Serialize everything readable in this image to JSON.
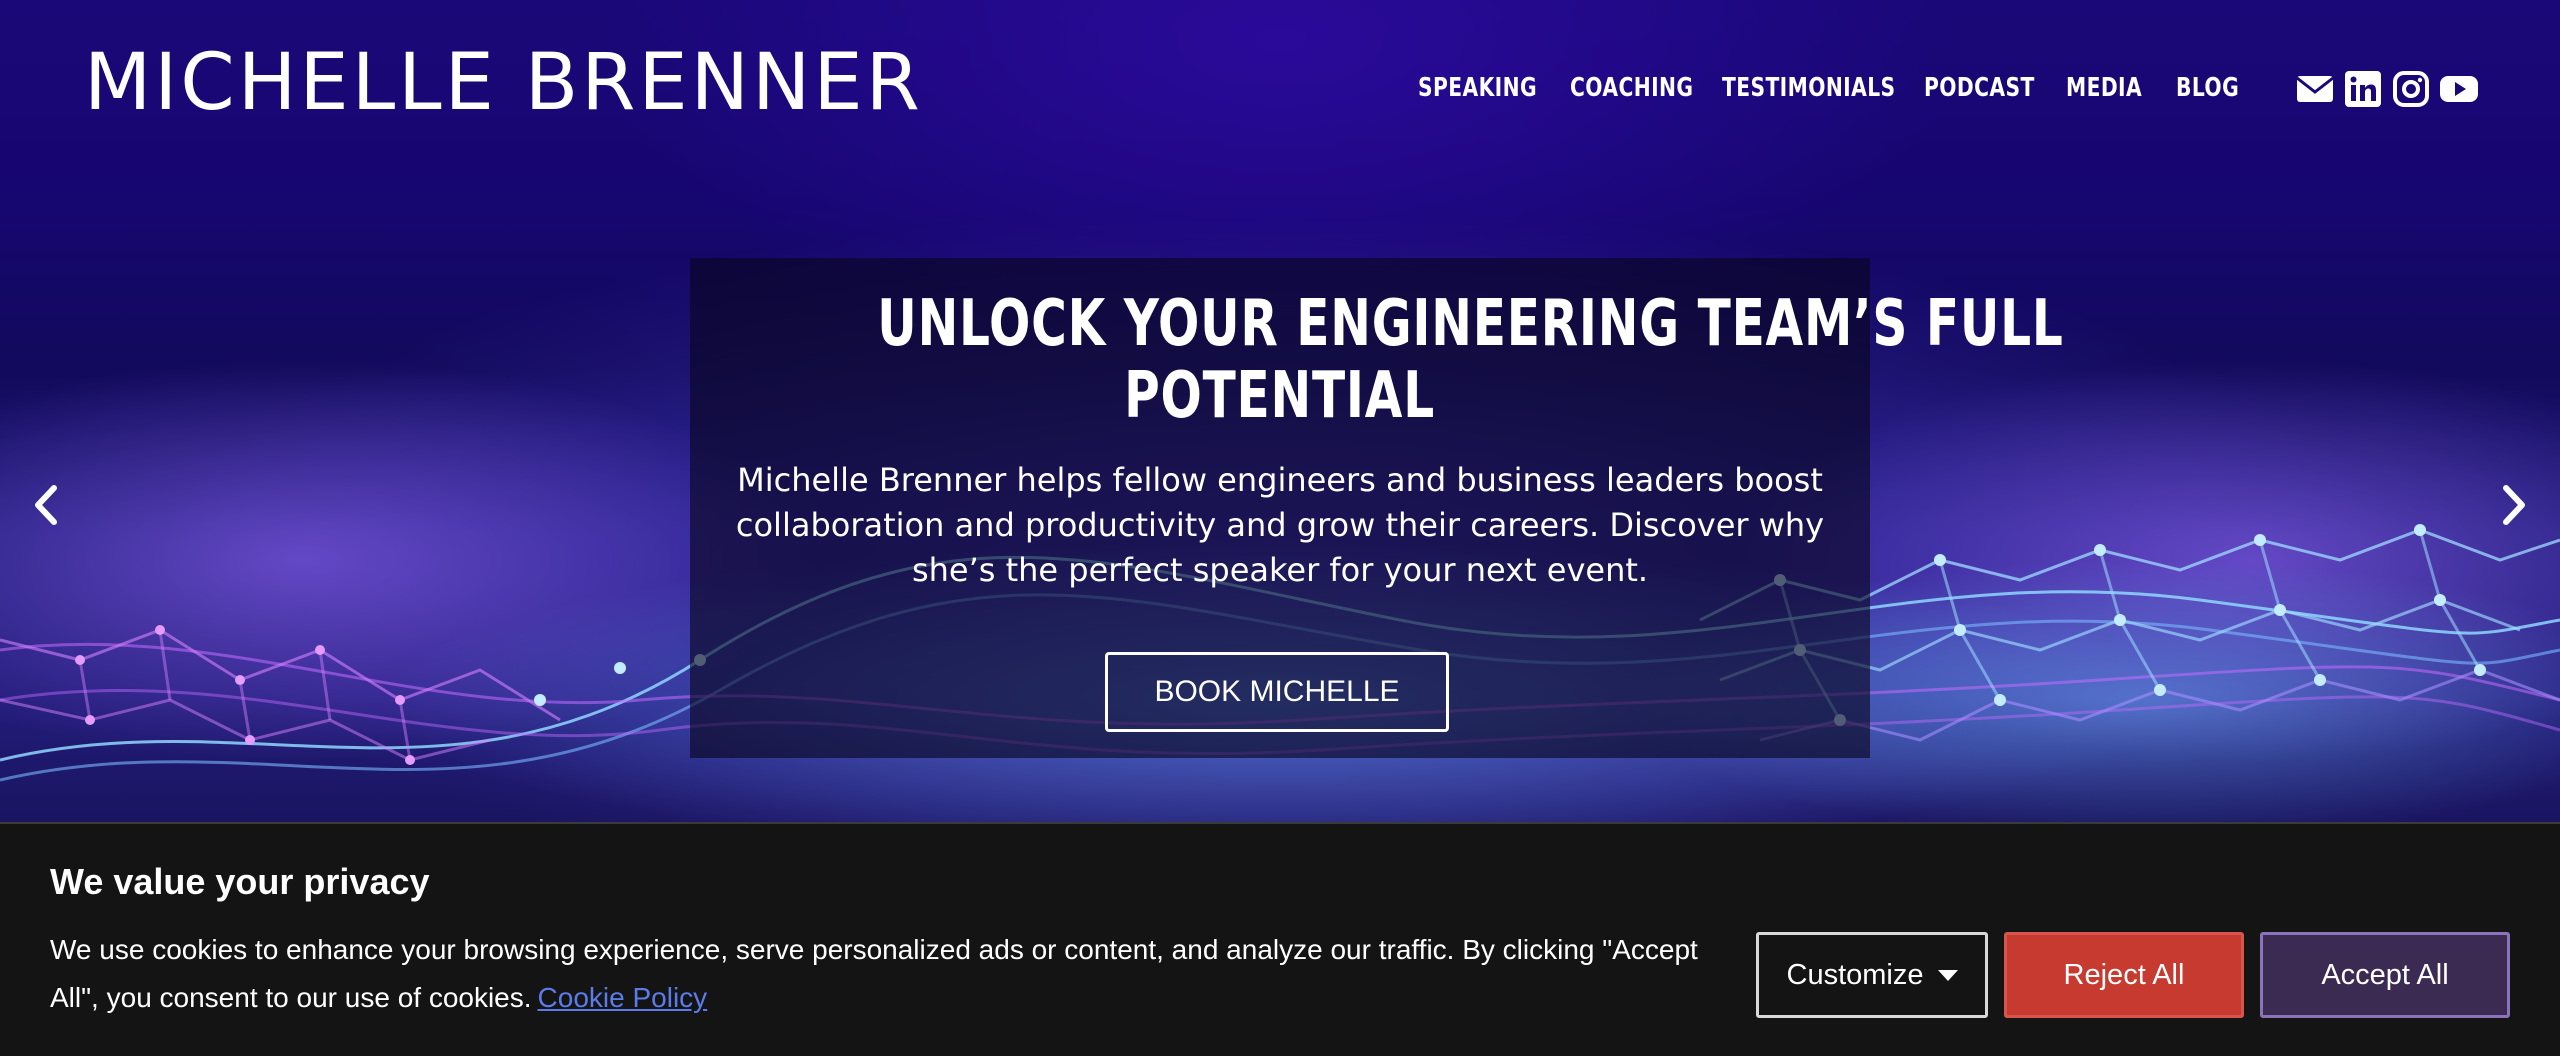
{
  "site": {
    "logo_text": "MICHELLE BRENNER"
  },
  "nav": {
    "items": [
      {
        "label": "SPEAKING"
      },
      {
        "label": "COACHING"
      },
      {
        "label": "TESTIMONIALS"
      },
      {
        "label": "PODCAST"
      },
      {
        "label": "MEDIA"
      },
      {
        "label": "BLOG"
      }
    ],
    "social_icons": [
      "email-icon",
      "linkedin-icon",
      "instagram-icon",
      "youtube-icon"
    ]
  },
  "hero": {
    "headline_line1": "UNLOCK YOUR ENGINEERING TEAM’S FULL",
    "headline_line2": "POTENTIAL",
    "subtext": "Michelle Brenner helps fellow engineers and business leaders boost collaboration and productivity and grow their careers. Discover why she’s the perfect speaker for your next event.",
    "cta_label": "BOOK MICHELLE",
    "prev_icon": "chevron-left-icon",
    "next_icon": "chevron-right-icon"
  },
  "cookie_banner": {
    "title": "We value your privacy",
    "body": "We use cookies to enhance your browsing experience, serve personalized ads or content, and analyze our traffic. By clicking \"Accept All\", you consent to our use of cookies.",
    "policy_link": "Cookie Policy",
    "customize_label": "Customize",
    "reject_label": "Reject All",
    "accept_label": "Accept All"
  },
  "colors": {
    "reject_bg": "#c63a2f",
    "accept_bg": "#3b2a52",
    "link": "#5b7be8",
    "hero_bg": "#1a0878"
  }
}
